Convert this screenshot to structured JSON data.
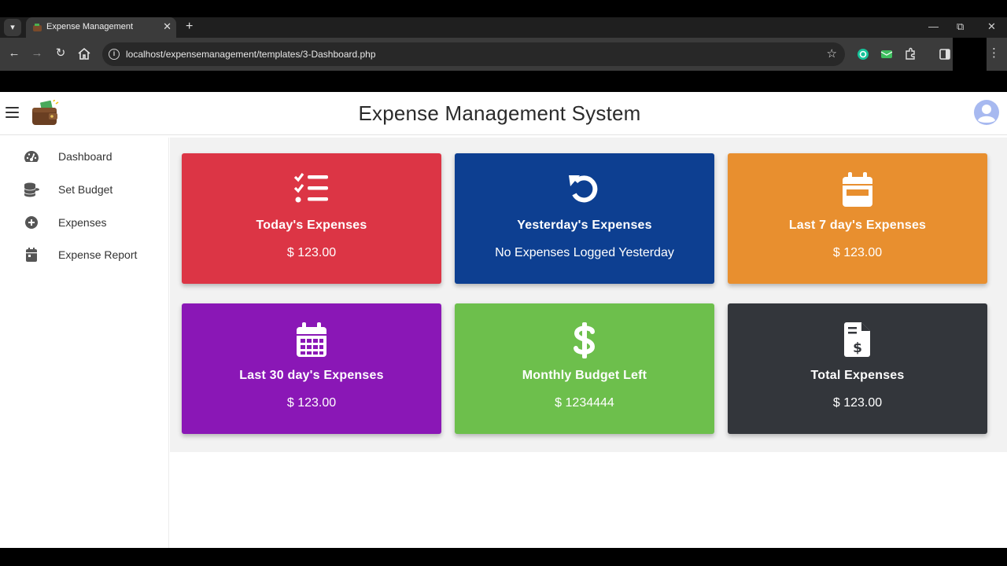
{
  "browser": {
    "tab_title": "Expense Management",
    "url": "localhost/expensemanagement/templates/3-Dashboard.php"
  },
  "app": {
    "title": "Expense Management System"
  },
  "sidebar": {
    "items": [
      {
        "label": "Dashboard",
        "icon": "gauge-icon"
      },
      {
        "label": "Set Budget",
        "icon": "coins-icon"
      },
      {
        "label": "Expenses",
        "icon": "plus-circle-icon"
      },
      {
        "label": "Expense Report",
        "icon": "calendar-icon"
      }
    ]
  },
  "cards": [
    {
      "title": "Today's Expenses",
      "value": "$ 123.00",
      "color": "#dc3545",
      "icon": "checklist-icon"
    },
    {
      "title": "Yesterday's Expenses",
      "value": "No Expenses Logged Yesterday",
      "color": "#0d3f91",
      "icon": "undo-icon"
    },
    {
      "title": "Last 7 day's Expenses",
      "value": "$ 123.00",
      "color": "#e88f2f",
      "icon": "calendar-week-icon"
    },
    {
      "title": "Last 30 day's Expenses",
      "value": "$ 123.00",
      "color": "#8a17b6",
      "icon": "calendar-days-icon"
    },
    {
      "title": "Monthly Budget Left",
      "value": "$ 1234444",
      "color": "#6dbf4c",
      "icon": "dollar-icon"
    },
    {
      "title": "Total Expenses",
      "value": "$ 123.00",
      "color": "#33363b",
      "icon": "invoice-icon"
    }
  ]
}
